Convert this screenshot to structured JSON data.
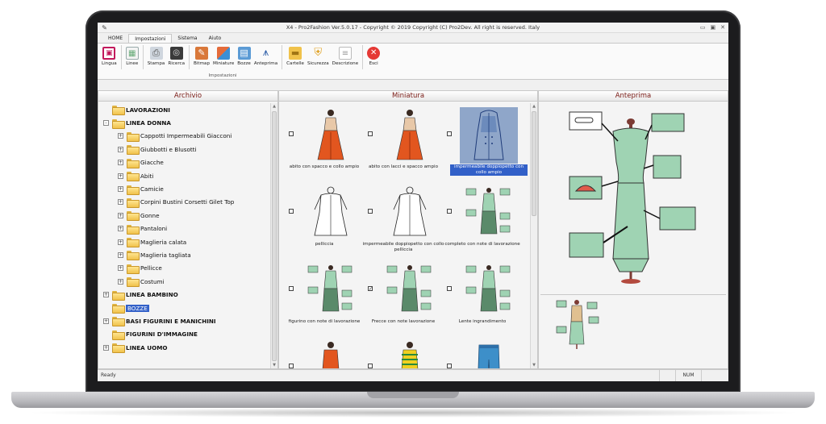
{
  "window": {
    "title": "X4 - Pro2Fashion Ver.5.0.17 - Copyright © 2019 Copyright (C) Pro2Dev. All right is reserved. Italy"
  },
  "menu_tabs": [
    "HOME",
    "Impostazioni",
    "Sistema",
    "Aiuto"
  ],
  "ribbon": {
    "buttons": [
      "Lingua",
      "Linee",
      "Stampa",
      "Ricerca",
      "Bitmap",
      "Miniature",
      "Bozze",
      "Anteprima",
      "Cartelle",
      "Sicurezza",
      "Descrizione",
      "Esci"
    ],
    "group_label": "Impostazioni"
  },
  "panels": {
    "archivio": "Archivio",
    "miniatura": "Miniatura",
    "anteprima": "Anteprima"
  },
  "tree": [
    {
      "label": "LAVORAZIONI",
      "level": 0,
      "bold": true,
      "exp": "none"
    },
    {
      "label": "LINEA DONNA",
      "level": 0,
      "bold": true,
      "exp": "-"
    },
    {
      "label": "Cappotti Impermeabili Giacconi",
      "level": 1,
      "exp": "+"
    },
    {
      "label": "Giubbotti e Blusotti",
      "level": 1,
      "exp": "+"
    },
    {
      "label": "Giacche",
      "level": 1,
      "exp": "+"
    },
    {
      "label": "Abiti",
      "level": 1,
      "exp": "+"
    },
    {
      "label": "Camicie",
      "level": 1,
      "exp": "+"
    },
    {
      "label": "Corpini Bustini Corsetti Gilet Top",
      "level": 1,
      "exp": "+"
    },
    {
      "label": "Gonne",
      "level": 1,
      "exp": "+"
    },
    {
      "label": "Pantaloni",
      "level": 1,
      "exp": "+"
    },
    {
      "label": "Maglieria calata",
      "level": 1,
      "exp": "+"
    },
    {
      "label": "Maglieria tagliata",
      "level": 1,
      "exp": "+"
    },
    {
      "label": "Pellicce",
      "level": 1,
      "exp": "+"
    },
    {
      "label": "Costumi",
      "level": 1,
      "exp": "+"
    },
    {
      "label": "LINEA BAMBINO",
      "level": 0,
      "bold": true,
      "exp": "+"
    },
    {
      "label": "BOZZE",
      "level": 0,
      "selected": true,
      "exp": "none"
    },
    {
      "label": "BASI FIGURINI E MANICHINI",
      "level": 0,
      "bold": true,
      "exp": "+"
    },
    {
      "label": "FIGURINI D'IMMAGINE",
      "level": 0,
      "bold": true,
      "exp": "none"
    },
    {
      "label": "LINEA UOMO",
      "level": 0,
      "bold": true,
      "exp": "+"
    }
  ],
  "thumbnails": [
    {
      "caption": "abito con spacco e collo ampio",
      "checked": false,
      "selected": false,
      "icon": "dress-orange-icon"
    },
    {
      "caption": "abito con lacci e spacco ampio",
      "checked": false,
      "selected": false,
      "icon": "dress-orange-icon"
    },
    {
      "caption": "impermeabile doppiopetto con collo ampio",
      "checked": false,
      "selected": true,
      "icon": "coat-blue-icon"
    },
    {
      "caption": "pelliccia",
      "checked": false,
      "selected": false,
      "icon": "sketch-icon"
    },
    {
      "caption": "impermeabile doppiopetto con collo pelliccia",
      "checked": false,
      "selected": false,
      "icon": "sketch-icon"
    },
    {
      "caption": "completo con note di lavorazione",
      "checked": false,
      "selected": false,
      "icon": "green-notes-icon"
    },
    {
      "caption": "figurino con note di lavorazione",
      "checked": false,
      "selected": false,
      "icon": "green-notes-icon"
    },
    {
      "caption": "Frecce con note lavorazione",
      "checked": true,
      "selected": false,
      "icon": "green-notes-icon"
    },
    {
      "caption": "Lente  ingrandimento",
      "checked": false,
      "selected": false,
      "icon": "green-notes-icon"
    },
    {
      "caption": "",
      "checked": false,
      "selected": false,
      "icon": "orange-top-icon"
    },
    {
      "caption": "",
      "checked": false,
      "selected": false,
      "icon": "striped-top-icon"
    },
    {
      "caption": "",
      "checked": false,
      "selected": false,
      "icon": "jeans-icon"
    }
  ],
  "status": {
    "left": "Ready",
    "num": "NUM"
  }
}
